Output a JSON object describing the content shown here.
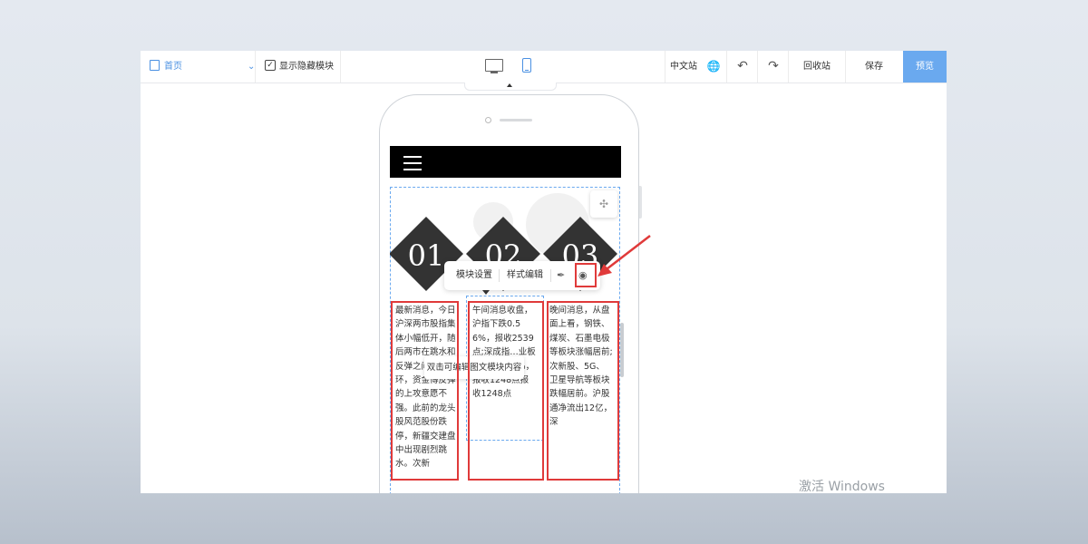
{
  "toolbar": {
    "page_select": "首页",
    "show_hidden_label": "显示隐藏模块",
    "language": "中文站",
    "recycle": "回收站",
    "save": "保存",
    "preview": "预览"
  },
  "module": {
    "numbers": [
      "01",
      "02",
      "03"
    ],
    "columns": [
      "最新消息，今日沪深两市股指集体小幅低开，随后两市在跳水和反弹之间反复循环，资金博反弹的上攻意愿不强。此前的龙头股风范股份跌停，新疆交建盘中出现剧烈跳水。次新",
      "午间消息收盘，沪指下跌0.56%，报收2539点;深成指…业板指下跌1.05%，报收1248点报收1248点",
      "晚间消息，从盘面上看，钢铁、煤炭、石墨电极等板块涨幅居前;次新股、5G、卫星导航等板块跌幅居前。沪股通净流出12亿，深"
    ]
  },
  "floatbar": {
    "module_settings": "模块设置",
    "style_edit": "样式编辑"
  },
  "hint": "双击可编辑图文模块内容",
  "watermark": "激活 Windows",
  "colors": {
    "accent": "#4a90e2",
    "preview_bg": "#6aa9ef",
    "highlight": "#e03a3a"
  }
}
